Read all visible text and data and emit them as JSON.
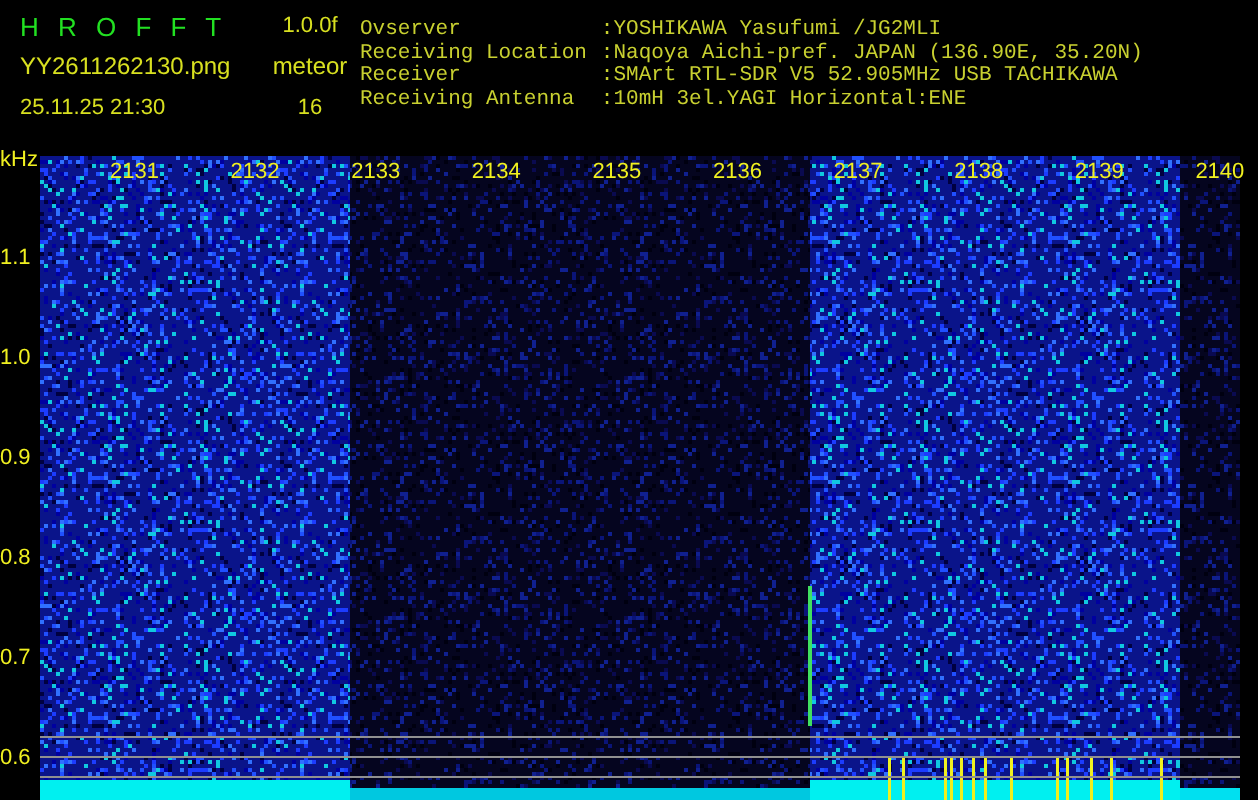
{
  "app": {
    "title": "H R O F F T",
    "version": "1.0.0f",
    "file": "YY2611262130.png",
    "timestamp": "25.11.25 21:30",
    "count_label": "meteor",
    "count": "16"
  },
  "station": [
    {
      "label": "Ovserver",
      "value": ":YOSHIKAWA Yasufumi /JG2MLI"
    },
    {
      "label": "Receiving Location",
      "value": ":Naqoya Aichi-pref. JAPAN (136.90E, 35.20N)"
    },
    {
      "label": "Receiver",
      "value": ":SMArt RTL-SDR V5 52.905MHz USB TACHIKAWA"
    },
    {
      "label": "Receiving Antenna",
      "value": ":10mH 3el.YAGI Horizontal:ENE"
    }
  ],
  "plot": {
    "y_unit": "kHz",
    "x_labels": [
      "2131",
      "2132",
      "2133",
      "2134",
      "2135",
      "2136",
      "2137",
      "2138",
      "2139",
      "2140"
    ],
    "y_labels": [
      "1.1",
      "1.0",
      "0.9",
      "0.8",
      "0.7",
      "0.6"
    ]
  }
}
